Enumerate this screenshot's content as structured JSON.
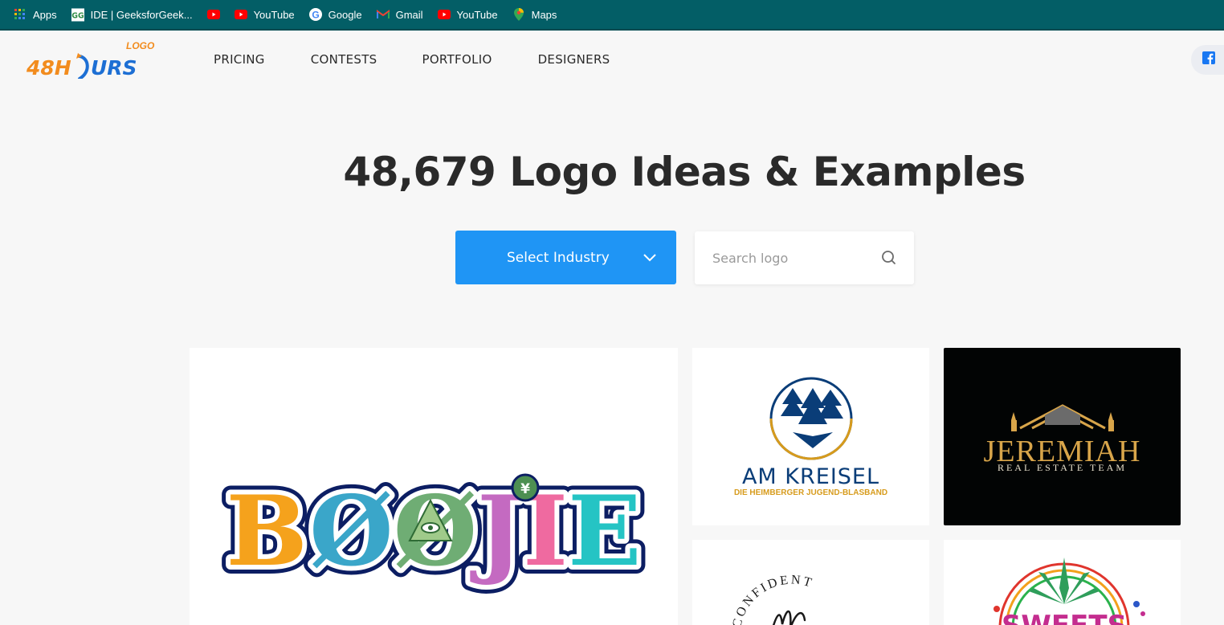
{
  "bookmarks": [
    {
      "label": "Apps",
      "icon": "apps-grid-icon"
    },
    {
      "label": "IDE | GeeksforGeek...",
      "icon": "geeksforgeeks-icon"
    },
    {
      "label": "",
      "icon": "youtube-icon"
    },
    {
      "label": "YouTube",
      "icon": "youtube-icon"
    },
    {
      "label": "Google",
      "icon": "google-icon"
    },
    {
      "label": "Gmail",
      "icon": "gmail-icon"
    },
    {
      "label": "YouTube",
      "icon": "youtube-icon"
    },
    {
      "label": "Maps",
      "icon": "maps-icon"
    }
  ],
  "site": {
    "logo_text": "48HOURS",
    "logo_tag": "LOGO",
    "nav": [
      "PRICING",
      "CONTESTS",
      "PORTFOLIO",
      "DESIGNERS"
    ],
    "social_icon": "facebook-icon"
  },
  "hero": {
    "title": "48,679 Logo Ideas & Examples",
    "select_label": "Select Industry",
    "search_placeholder": "Search logo"
  },
  "gallery": {
    "boojie": "BØØJIE",
    "am_title": "AM KREISEL",
    "am_subtitle": "DIE HEIMBERGER JUGEND-BLASBAND",
    "jeremiah_title": "JEREMIAH",
    "jeremiah_subtitle": "REAL ESTATE TEAM",
    "confident_text": "CONFIDENT",
    "sweets_text": "SWEETS"
  },
  "colors": {
    "bookmark_bar": "#035e66",
    "accent_blue": "#1f95f5",
    "logo_orange": "#f28c1e",
    "logo_blue": "#1d6fd4"
  }
}
